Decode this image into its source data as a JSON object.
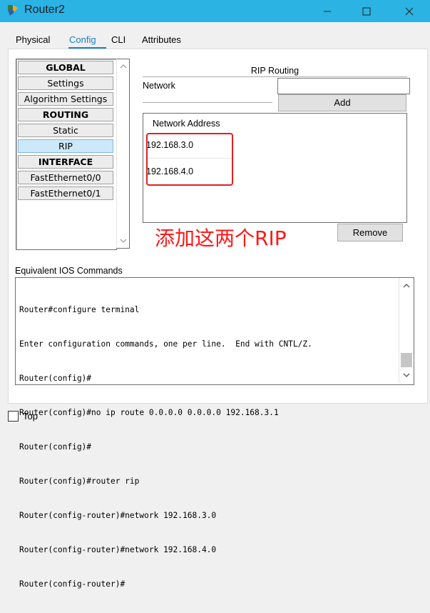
{
  "window": {
    "title": "Router2"
  },
  "tabs": [
    {
      "label": "Physical"
    },
    {
      "label": "Config"
    },
    {
      "label": "CLI"
    },
    {
      "label": "Attributes"
    }
  ],
  "sidebar": {
    "items": [
      {
        "label": "GLOBAL"
      },
      {
        "label": "Settings"
      },
      {
        "label": "Algorithm Settings"
      },
      {
        "label": "ROUTING"
      },
      {
        "label": "Static"
      },
      {
        "label": "RIP"
      },
      {
        "label": "INTERFACE"
      },
      {
        "label": "FastEthernet0/0"
      },
      {
        "label": "FastEthernet0/1"
      }
    ],
    "selected": "RIP"
  },
  "rip": {
    "title": "RIP Routing",
    "network_label": "Network",
    "network_value": "",
    "add_label": "Add",
    "list_header": "Network Address",
    "networks": [
      "192.168.3.0",
      "192.168.4.0"
    ],
    "remove_label": "Remove"
  },
  "annotation": {
    "text": "添加这两个RIP",
    "color": "#ff1818"
  },
  "ios": {
    "label": "Equivalent IOS Commands",
    "lines": [
      "Router#configure terminal",
      "Enter configuration commands, one per line.  End with CNTL/Z.",
      "Router(config)#",
      "Router(config)#no ip route 0.0.0.0 0.0.0.0 192.168.3.1",
      "Router(config)#",
      "Router(config)#router rip",
      "Router(config-router)#network 192.168.3.0",
      "Router(config-router)#network 192.168.4.0",
      "Router(config-router)#"
    ]
  },
  "footer": {
    "top_label": "Top",
    "top_checked": false
  },
  "colors": {
    "titlebar": "#2ab3e3",
    "accent": "#1a7fc6",
    "annotation": "#ff1818"
  },
  "icons": [
    "router-app-icon",
    "minimize-icon",
    "maximize-icon",
    "close-icon",
    "scroll-up-icon",
    "scroll-down-icon"
  ]
}
